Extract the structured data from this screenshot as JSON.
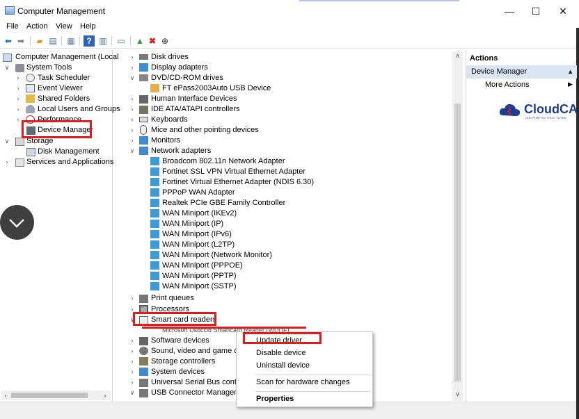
{
  "window": {
    "title": "Computer Management",
    "controls": {
      "minimize": "—",
      "maximize": "☐",
      "close": "✕"
    }
  },
  "menu": {
    "file": "File",
    "action": "Action",
    "view": "View",
    "help": "Help"
  },
  "toolbar": {
    "icons": [
      "back-arrow-icon",
      "forward-arrow-icon",
      "up-folder-icon",
      "show-hide-tree-icon",
      "properties-icon",
      "help-icon",
      "view-icon",
      "monitor-icon",
      "scan-hardware-icon",
      "uninstall-x-icon",
      "update-driver-icon"
    ]
  },
  "tree": {
    "root": "Computer Management (Local",
    "system_tools": "System Tools",
    "task_scheduler": "Task Scheduler",
    "event_viewer": "Event Viewer",
    "shared_folders": "Shared Folders",
    "local_users": "Local Users and Groups",
    "performance": "Performance",
    "device_manager": "Device Manager",
    "storage": "Storage",
    "disk_management": "Disk Management",
    "services": "Services and Applications"
  },
  "devices": {
    "disk_drives": "Disk drives",
    "display_adapters": "Display adapters",
    "dvd": "DVD/CD-ROM drives",
    "dvd_child": "FT ePass2003Auto USB Device",
    "hid": "Human Interface Devices",
    "ide": "IDE ATA/ATAPI controllers",
    "keyboards": "Keyboards",
    "mice": "Mice and other pointing devices",
    "monitors": "Monitors",
    "network": "Network adapters",
    "net_children": [
      "Broadcom 802.11n Network Adapter",
      "Fortinet SSL VPN Virtual Ethernet Adapter",
      "Fortinet Virtual Ethernet Adapter (NDIS 6.30)",
      "PPPoP WAN Adapter",
      "Realtek PCIe GBE Family Controller",
      "WAN Miniport (IKEv2)",
      "WAN Miniport (IP)",
      "WAN Miniport (IPv6)",
      "WAN Miniport (L2TP)",
      "WAN Miniport (Network Monitor)",
      "WAN Miniport (PPPOE)",
      "WAN Miniport (PPTP)",
      "WAN Miniport (SSTP)"
    ],
    "print_queues": "Print queues",
    "processors": "Processors",
    "smart_card": "Smart card readers",
    "smart_card_child": "Microsoft Usbccid Smartcard Reader (WUDF)",
    "software_devices": "Software devices",
    "sound": "Sound, video and game con",
    "storage_controllers": "Storage controllers",
    "system_devices": "System devices",
    "usb": "Universal Serial Bus controll",
    "usb_connector": "USB Connector Managers"
  },
  "actions": {
    "header": "Actions",
    "section": "Device Manager",
    "more": "More Actions"
  },
  "logo": {
    "brand": "CloudCA",
    "tagline": "GIẢI PHÁP SỐ TRỰC TUYẾN"
  },
  "context_menu": {
    "update": "Update driver",
    "disable": "Disable device",
    "uninstall": "Uninstall device",
    "scan": "Scan for hardware changes",
    "properties": "Properties"
  },
  "colors": {
    "highlight": "#e01c1c",
    "actions_section_bg": "#dbe6f4",
    "brand_blue": "#1f3e92",
    "brand_red": "#d9262c"
  }
}
